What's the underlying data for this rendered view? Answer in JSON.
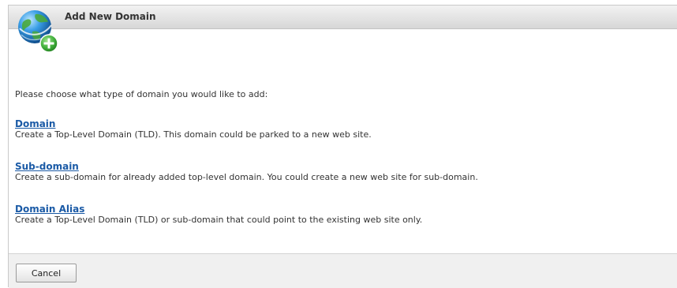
{
  "header": {
    "title": "Add New Domain",
    "icon": "globe-add-icon"
  },
  "intro": "Please choose what type of domain you would like to add:",
  "options": [
    {
      "label": "Domain",
      "description": "Create a Top-Level Domain (TLD). This domain could be parked to a new web site."
    },
    {
      "label": "Sub-domain",
      "description": "Create a sub-domain for already added top-level domain. You could create a new web site for sub-domain."
    },
    {
      "label": "Domain Alias",
      "description": "Create a Top-Level Domain (TLD) or sub-domain that could point to the existing web site only."
    }
  ],
  "footer": {
    "cancel_label": "Cancel"
  },
  "colors": {
    "link": "#1a5aa6",
    "text": "#333333",
    "title_bar": "#dcdcdc",
    "plus_badge": "#3fae3a"
  }
}
